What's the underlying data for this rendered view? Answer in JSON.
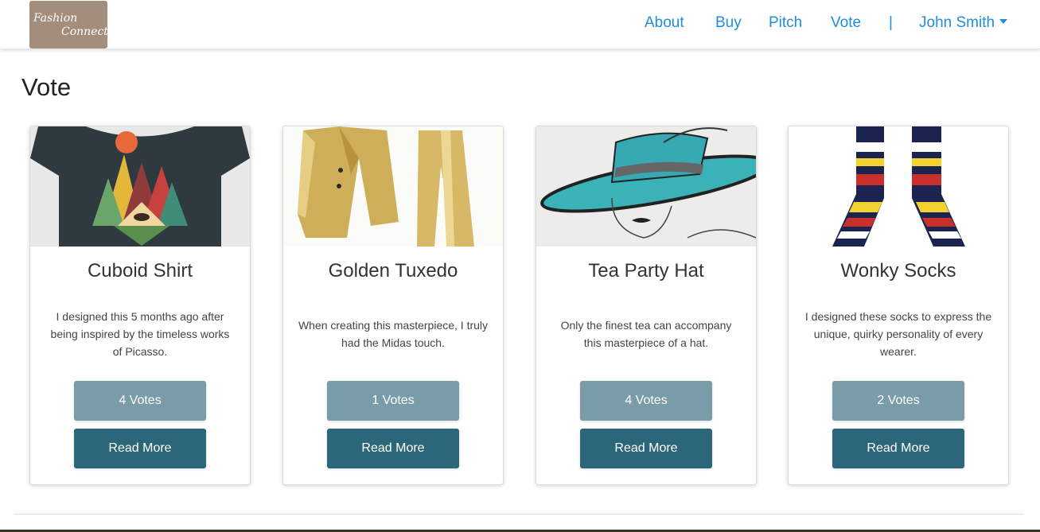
{
  "brand": {
    "line1": "Fashion",
    "line2": "Connect"
  },
  "nav": {
    "about": "About",
    "buy": "Buy",
    "pitch": "Pitch",
    "vote": "Vote",
    "separator": "|",
    "user": "John Smith"
  },
  "page": {
    "title": "Vote"
  },
  "cards": [
    {
      "title": "Cuboid Shirt",
      "description": "I designed this 5 months ago after being inspired by the timeless works of Picasso.",
      "votes": "4 Votes",
      "read_more": "Read More"
    },
    {
      "title": "Golden Tuxedo",
      "description": "When creating this masterpiece, I truly had the Midas touch.",
      "votes": "1 Votes",
      "read_more": "Read More"
    },
    {
      "title": "Tea Party Hat",
      "description": "Only the finest tea can accompany this masterpiece of a hat.",
      "votes": "4 Votes",
      "read_more": "Read More"
    },
    {
      "title": "Wonky Socks",
      "description": "I designed these socks to express the unique, quirky personality of every wearer.",
      "votes": "2 Votes",
      "read_more": "Read More"
    }
  ],
  "colors": {
    "link": "#1e8fd8",
    "votes_button": "#7a9ca8",
    "read_more_button": "#2c6679",
    "logo_bg": "#a38d7c"
  }
}
